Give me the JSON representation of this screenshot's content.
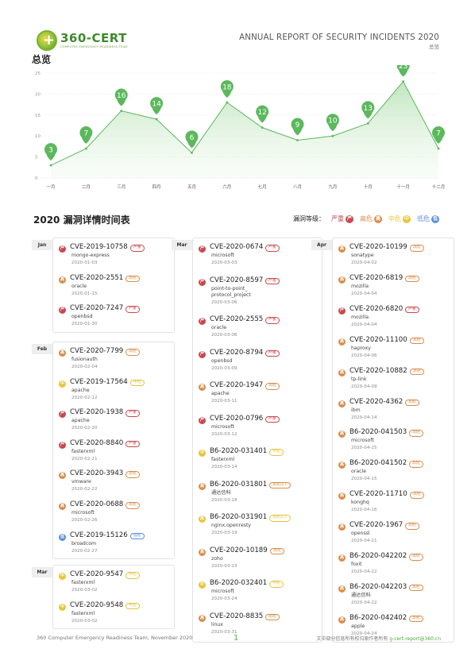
{
  "header": {
    "logo_name": "360-CERT",
    "logo_sub": "COMPUTER EMERGENCY READINESS TEAM",
    "report_title": "ANNUAL REPORT OF SECURITY INCIDENTS 2020",
    "report_sub": "总览"
  },
  "overview_title": "总览",
  "chart_data": {
    "type": "area",
    "categories": [
      "一月",
      "二月",
      "三月",
      "四月",
      "五月",
      "六月",
      "七月",
      "八月",
      "九月",
      "十月",
      "十一月",
      "十二月"
    ],
    "values": [
      3,
      7,
      16,
      14,
      6,
      18,
      12,
      9,
      10,
      13,
      23,
      7
    ],
    "yticks": [
      0,
      5,
      10,
      15,
      20,
      25
    ],
    "ylim": [
      0,
      25
    ],
    "color": "#5cb85c"
  },
  "timeline_title": "2020 漏洞详情时间表",
  "legend": {
    "title": "漏洞等级：",
    "items": [
      {
        "label": "严重",
        "color": "#c9484e",
        "icon": "严"
      },
      {
        "label": "高危",
        "color": "#d88c4a",
        "icon": "高"
      },
      {
        "label": "中危",
        "color": "#e8c43a",
        "icon": "中"
      },
      {
        "label": "低危",
        "color": "#5b8fd6",
        "icon": "低"
      }
    ]
  },
  "colors": {
    "sev": "#c9484e",
    "high": "#d88c4a",
    "mid": "#e8c43a",
    "low": "#5b8fd6"
  },
  "columns": [
    {
      "groups": [
        {
          "month": "Jan",
          "entries": [
            {
              "id": "CVE-2019-10758",
              "tag": "严重",
              "lvl": "sev",
              "vendor": "mongo-express",
              "date": "2020-01-03"
            },
            {
              "id": "CVE-2020-2551",
              "tag": "高危",
              "lvl": "high",
              "vendor": "oracle",
              "date": "2020-01-15"
            },
            {
              "id": "CVE-2020-7247",
              "tag": "严重",
              "lvl": "sev",
              "vendor": "openbsd",
              "date": "2020-01-30"
            }
          ]
        },
        {
          "month": "Feb",
          "entries": [
            {
              "id": "CVE-2020-7799",
              "tag": "高危",
              "lvl": "high",
              "vendor": "fusionauth",
              "date": "2020-02-04"
            },
            {
              "id": "CVE-2019-17564",
              "tag": "中危",
              "lvl": "mid",
              "vendor": "apache",
              "date": "2020-02-12"
            },
            {
              "id": "CVE-2020-1938",
              "tag": "严重",
              "lvl": "sev",
              "vendor": "apache",
              "date": "2020-02-20"
            },
            {
              "id": "CVE-2020-8840",
              "tag": "严重",
              "lvl": "sev",
              "vendor": "fasterxml",
              "date": "2020-02-21"
            },
            {
              "id": "CVE-2020-3943",
              "tag": "高危",
              "lvl": "high",
              "vendor": "vmware",
              "date": "2020-02-22"
            },
            {
              "id": "CVE-2020-0688",
              "tag": "高危",
              "lvl": "high",
              "vendor": "microsoft",
              "date": "2020-02-26"
            },
            {
              "id": "CVE-2019-15126",
              "tag": "低危",
              "lvl": "low",
              "vendor": "broadcom",
              "date": "2020-02-27"
            }
          ]
        },
        {
          "month": "Mar",
          "entries": [
            {
              "id": "CVE-2020-9547",
              "tag": "中危",
              "lvl": "mid",
              "vendor": "fasterxml",
              "date": "2020-03-02"
            },
            {
              "id": "CVE-2020-9548",
              "tag": "中危",
              "lvl": "mid",
              "vendor": "fasterxml",
              "date": "2020-03-02"
            }
          ]
        }
      ]
    },
    {
      "groups": [
        {
          "month": "Mar",
          "entries": [
            {
              "id": "CVE-2020-0674",
              "tag": "严重",
              "lvl": "sev",
              "vendor": "microsoft",
              "date": "2020-03-03"
            },
            {
              "id": "CVE-2020-8597",
              "tag": "严重",
              "lvl": "sev",
              "vendor": "point-to-point_\nprotocol_project",
              "date": "2020-03-06"
            },
            {
              "id": "CVE-2020-2555",
              "tag": "严重",
              "lvl": "sev",
              "vendor": "oracle",
              "date": "2020-03-06"
            },
            {
              "id": "CVE-2020-8794",
              "tag": "严重",
              "lvl": "sev",
              "vendor": "openbsd",
              "date": "2020-03-09"
            },
            {
              "id": "CVE-2020-1947",
              "tag": "高危",
              "lvl": "high",
              "vendor": "apache",
              "date": "2020-03-11"
            },
            {
              "id": "CVE-2020-0796",
              "tag": "严重",
              "lvl": "sev",
              "vendor": "microsoft",
              "date": "2020-03-12"
            },
            {
              "id": "B6-2020-031401",
              "tag": "中危",
              "lvl": "mid",
              "vendor": "fasterxml",
              "date": "2020-03-14"
            },
            {
              "id": "B6-2020-031801",
              "tag": "高危以下",
              "lvl": "high",
              "vendor": "通达信科",
              "date": "2020-03-18"
            },
            {
              "id": "B6-2020-031901",
              "tag": "高危以下",
              "lvl": "mid",
              "vendor": "nginx,openresty",
              "date": "2020-03-19"
            },
            {
              "id": "CVE-2020-10189",
              "tag": "高危",
              "lvl": "high",
              "vendor": "zoho",
              "date": "2020-03-23"
            },
            {
              "id": "B6-2020-032401",
              "tag": "中危",
              "lvl": "mid",
              "vendor": "microsoft",
              "date": "2020-03-24"
            },
            {
              "id": "CVE-2020-8835",
              "tag": "高危",
              "lvl": "high",
              "vendor": "linux",
              "date": "2020-03-31"
            }
          ]
        }
      ]
    },
    {
      "groups": [
        {
          "month": "Apr",
          "entries": [
            {
              "id": "CVE-2020-10199",
              "tag": "高危",
              "lvl": "high",
              "vendor": "sonatype",
              "date": "2020-04-02"
            },
            {
              "id": "CVE-2020-6819",
              "tag": "高危",
              "lvl": "high",
              "vendor": "mozilla",
              "date": "2020-04-04"
            },
            {
              "id": "CVE-2020-6820",
              "tag": "严重",
              "lvl": "sev",
              "vendor": "mozilla",
              "date": "2020-04-04"
            },
            {
              "id": "CVE-2020-11100",
              "tag": "高危",
              "lvl": "high",
              "vendor": "haproxy",
              "date": "2020-04-06"
            },
            {
              "id": "CVE-2020-10882",
              "tag": "高危",
              "lvl": "high",
              "vendor": "tp-link",
              "date": "2020-04-09"
            },
            {
              "id": "CVE-2020-4362",
              "tag": "高危",
              "lvl": "high",
              "vendor": "ibm",
              "date": "2020-04-14"
            },
            {
              "id": "B6-2020-041503",
              "tag": "高危",
              "lvl": "high",
              "vendor": "microsoft",
              "date": "2020-04-15"
            },
            {
              "id": "B6-2020-041502",
              "tag": "高危",
              "lvl": "high",
              "vendor": "oracle",
              "date": "2020-04-15"
            },
            {
              "id": "CVE-2020-11710",
              "tag": "高危",
              "lvl": "high",
              "vendor": "konghq",
              "date": "2020-04-16"
            },
            {
              "id": "CVE-2020-1967",
              "tag": "高危",
              "lvl": "high",
              "vendor": "openssl",
              "date": "2020-04-21"
            },
            {
              "id": "B6-2020-042202",
              "tag": "高危",
              "lvl": "high",
              "vendor": "foxit",
              "date": "2020-04-22"
            },
            {
              "id": "B6-2020-042203",
              "tag": "高危",
              "lvl": "high",
              "vendor": "通达信科",
              "date": "2020-04-22"
            },
            {
              "id": "B6-2020-042402",
              "tag": "高危",
              "lvl": "high",
              "vendor": "apple",
              "date": "2020-04-24"
            }
          ]
        }
      ]
    }
  ],
  "footer": {
    "left": "360 Computer Emergency Readiness Team, November 2020",
    "page": "1",
    "right_text": "文中部分信息所有权归原作者所有 ",
    "email": "g-cert-report@360.cn"
  }
}
